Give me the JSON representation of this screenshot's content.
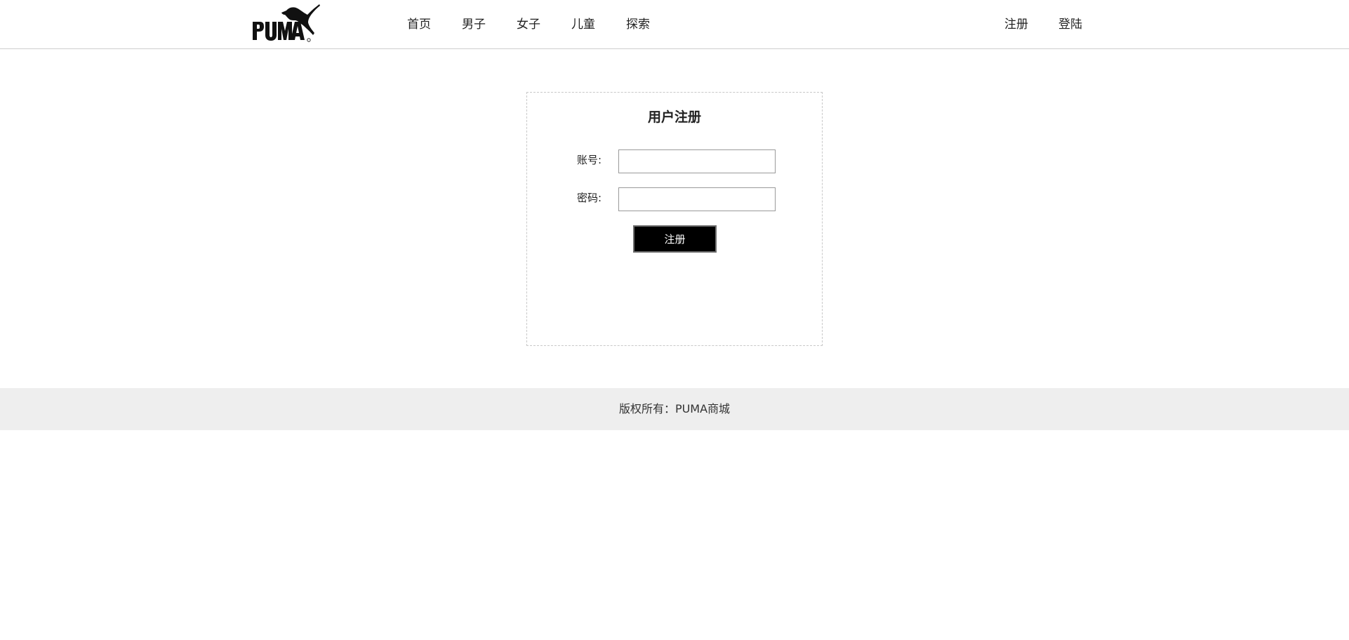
{
  "header": {
    "logo_text": "PUMA",
    "nav_items": [
      {
        "label": "首页"
      },
      {
        "label": "男子"
      },
      {
        "label": "女子"
      },
      {
        "label": "儿童"
      },
      {
        "label": "探索"
      }
    ],
    "auth_links": [
      {
        "label": "注册"
      },
      {
        "label": "登陆"
      }
    ]
  },
  "register_form": {
    "title": "用户注册",
    "account_label": "账号:",
    "account_value": "",
    "password_label": "密码:",
    "password_value": "",
    "submit_label": "注册"
  },
  "footer": {
    "copyright": "版权所有：PUMA商城"
  },
  "colors": {
    "brand": "#000000",
    "button_bg": "#000000",
    "button_text": "#ffffff",
    "footer_bg": "#eeeeee"
  }
}
